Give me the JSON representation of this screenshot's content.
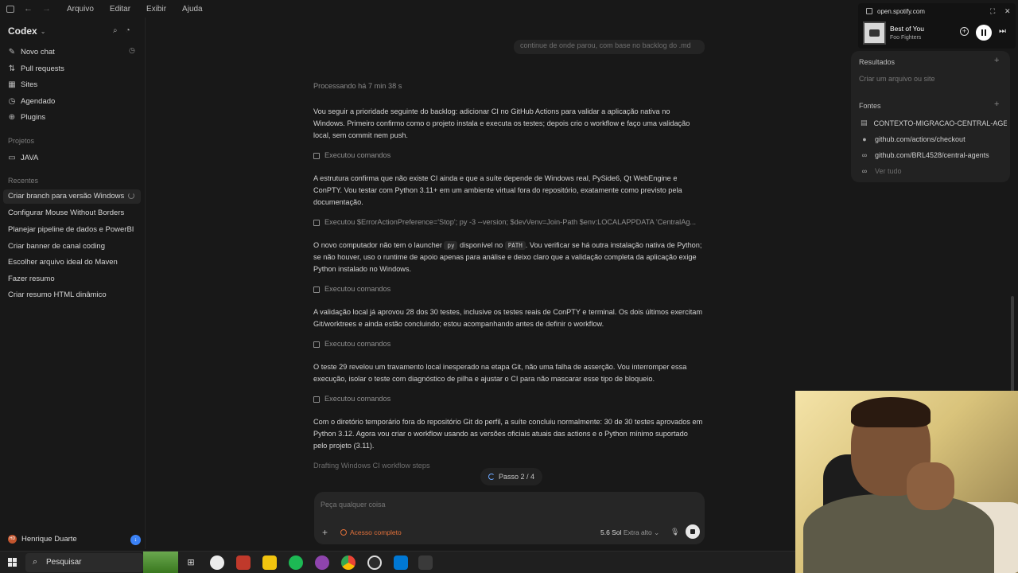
{
  "menubar": {
    "items": [
      "Arquivo",
      "Editar",
      "Exibir",
      "Ajuda"
    ]
  },
  "sidebar": {
    "brand": "Codex",
    "nav": [
      {
        "label": "Novo chat",
        "icon": "edit-icon"
      },
      {
        "label": "Pull requests",
        "icon": "pull-request-icon"
      },
      {
        "label": "Sites",
        "icon": "grid-icon"
      },
      {
        "label": "Agendado",
        "icon": "clock-icon"
      },
      {
        "label": "Plugins",
        "icon": "plug-icon"
      }
    ],
    "projects_label": "Projetos",
    "projects": [
      "JAVA"
    ],
    "recent_label": "Recentes",
    "recent": [
      "Criar branch para versão Windows",
      "Configurar Mouse Without Borders",
      "Planejar pipeline de dados e PowerBI",
      "Criar banner de canal coding",
      "Escolher arquivo ideal do Maven",
      "Fazer resumo",
      "Criar resumo HTML dinâmico"
    ],
    "user": {
      "name": "Henrique Duarte",
      "initials": "HD"
    }
  },
  "main": {
    "prev_message": "continue de onde parou, com base no backlog do .md",
    "processing": "Processando há 7 min 38 s",
    "p1": "Vou seguir a prioridade seguinte do backlog: adicionar CI no GitHub Actions para validar a aplicação nativa no Windows. Primeiro confirmo como o projeto instala e executa os testes; depois crio o workflow e faço uma validação local, sem commit nem push.",
    "cmd1": "Executou comandos",
    "p2": "A estrutura confirma que não existe CI ainda e que a suíte depende de Windows real, PySide6, Qt WebEngine e ConPTY. Vou testar com Python 3.11+ em um ambiente virtual fora do repositório, exatamente como previsto pela documentação.",
    "cmd2": "Executou $ErrorActionPreference='Stop'; py -3 --version; $devVenv=Join-Path $env:LOCALAPPDATA 'CentralAg...",
    "p3_a": "O novo computador não tem o launcher ",
    "p3_code1": "py",
    "p3_b": " disponível no ",
    "p3_code2": "PATH",
    "p3_c": ". Vou verificar se há outra instalação nativa de Python; se não houver, uso o runtime de apoio apenas para análise e deixo claro que a validação completa da aplicação exige Python instalado no Windows.",
    "cmd3": "Executou comandos",
    "p4": "A validação local já aprovou 28 dos 30 testes, inclusive os testes reais de ConPTY e terminal. Os dois últimos exercitam Git/worktrees e ainda estão concluindo; estou acompanhando antes de definir o workflow.",
    "cmd4": "Executou comandos",
    "p5": "O teste 29 revelou um travamento local inesperado na etapa Git, não uma falha de asserção. Vou interromper essa execução, isolar o teste com diagnóstico de pilha e ajustar o CI para não mascarar esse tipo de bloqueio.",
    "cmd5": "Executou comandos",
    "p6": "Com o diretório temporário fora do repositório Git do perfil, a suíte concluiu normalmente: 30 de 30 testes aprovados em Python 3.12. Agora vou criar o workflow usando as versões oficiais atuais das actions e o Python mínimo suportado pelo projeto (3.11).",
    "drafting": "Drafting Windows CI workflow steps",
    "step": "Passo 2 / 4"
  },
  "composer": {
    "placeholder": "Peça qualquer coisa",
    "access": "Acesso completo",
    "model": "5.6 Sol",
    "effort": "Extra alto"
  },
  "panel": {
    "results_label": "Resultados",
    "results_hint": "Criar um arquivo ou site",
    "sources_label": "Fontes",
    "sources": [
      {
        "label": "CONTEXTO-MIGRACAO-CENTRAL-AGE",
        "icon": "file-icon"
      },
      {
        "label": "github.com/actions/checkout",
        "icon": "github-icon"
      },
      {
        "label": "github.com/BRL4528/central-agents",
        "icon": "link-icon"
      }
    ],
    "see_all": "Ver tudo"
  },
  "spotify": {
    "url": "open.spotify.com",
    "song": "Best of You",
    "artist": "Foo Fighters"
  },
  "taskbar": {
    "search": "Pesquisar"
  },
  "colors": {
    "accent_orange": "#e0703a",
    "accent_blue": "#3b82f6",
    "background": "#181818"
  }
}
